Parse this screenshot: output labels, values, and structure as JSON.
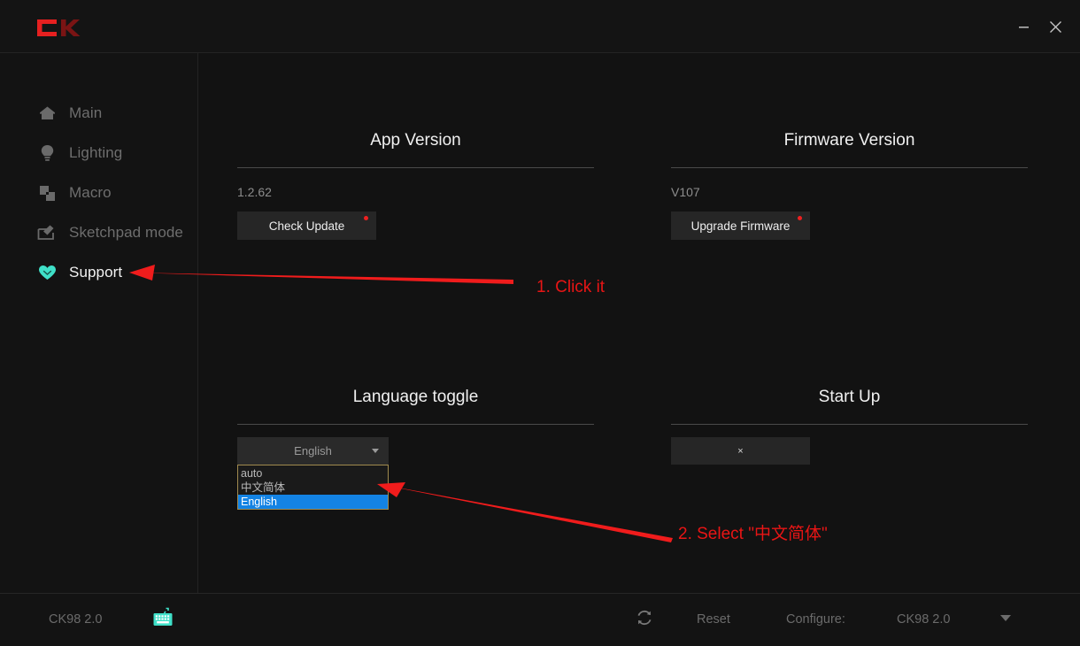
{
  "window": {
    "logo": "CK",
    "logo_color": "#e62020",
    "minimize_label": "minimize",
    "close_label": "close"
  },
  "sidebar": {
    "items": [
      {
        "label": "Main",
        "icon": "home-icon",
        "active": false
      },
      {
        "label": "Lighting",
        "icon": "bulb-icon",
        "active": false
      },
      {
        "label": "Macro",
        "icon": "macro-icon",
        "active": false
      },
      {
        "label": "Sketchpad mode",
        "icon": "sketchpad-icon",
        "active": false
      },
      {
        "label": "Support",
        "icon": "heart-icon",
        "active": true
      }
    ],
    "active_color": "#3fe0c8"
  },
  "main": {
    "app_version": {
      "title": "App Version",
      "value": "1.2.62",
      "button_label": "Check Update",
      "has_badge": true
    },
    "firmware_version": {
      "title": "Firmware Version",
      "value": "V107",
      "button_label": "Upgrade Firmware",
      "has_badge": true
    },
    "language_toggle": {
      "title": "Language toggle",
      "selected": "English",
      "expanded": true,
      "options": [
        {
          "label": "auto",
          "selected": false
        },
        {
          "label": "中文简体",
          "selected": false
        },
        {
          "label": "English",
          "selected": true
        }
      ],
      "highlight_color": "#1383e4",
      "border_color": "#a08a4e"
    },
    "start_up": {
      "title": "Start Up",
      "button_label": "×"
    }
  },
  "statusbar": {
    "device": "CK98 2.0",
    "keyboard_icon": "keyboard-icon",
    "refresh_icon": "refresh-icon",
    "reset_label": "Reset",
    "configure_label": "Configure:",
    "configure_value": "CK98 2.0"
  },
  "annotations": {
    "color": "#e81515",
    "step1": "1. Click it",
    "step2": "2. Select \"中文简体\""
  }
}
